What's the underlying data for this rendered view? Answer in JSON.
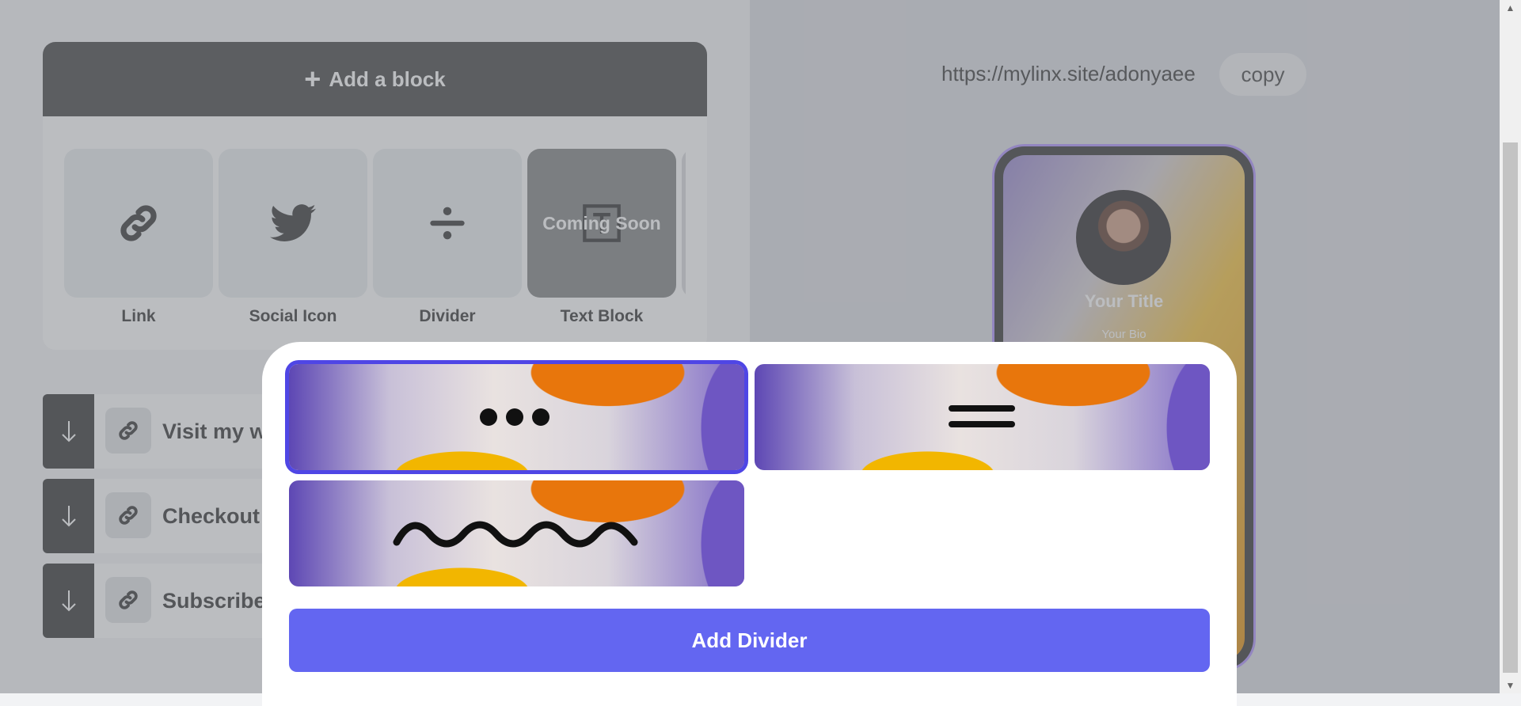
{
  "editor": {
    "add_block_label": "Add a block",
    "block_types": [
      {
        "label": "Link",
        "icon": "link-icon"
      },
      {
        "label": "Social Icon",
        "icon": "twitter-icon"
      },
      {
        "label": "Divider",
        "icon": "divide-icon"
      },
      {
        "label": "Text Block",
        "icon": "text-icon",
        "badge": "Coming Soon"
      }
    ],
    "links": [
      {
        "title": "Visit my website"
      },
      {
        "title": "Checkout my store"
      },
      {
        "title": "Subscribe to my channel"
      }
    ]
  },
  "preview": {
    "url": "https://mylinx.site/adonyaee",
    "copy_label": "copy",
    "profile_title": "Your Title",
    "profile_bio": "Your Bio"
  },
  "modal": {
    "divider_styles": [
      "dots-divider",
      "double-line-divider",
      "wave-divider"
    ],
    "selected_style": "dots-divider",
    "confirm_label": "Add Divider"
  },
  "colors": {
    "accent": "#6366f1",
    "header_dark": "#525252",
    "selection": "#4f46e5"
  }
}
